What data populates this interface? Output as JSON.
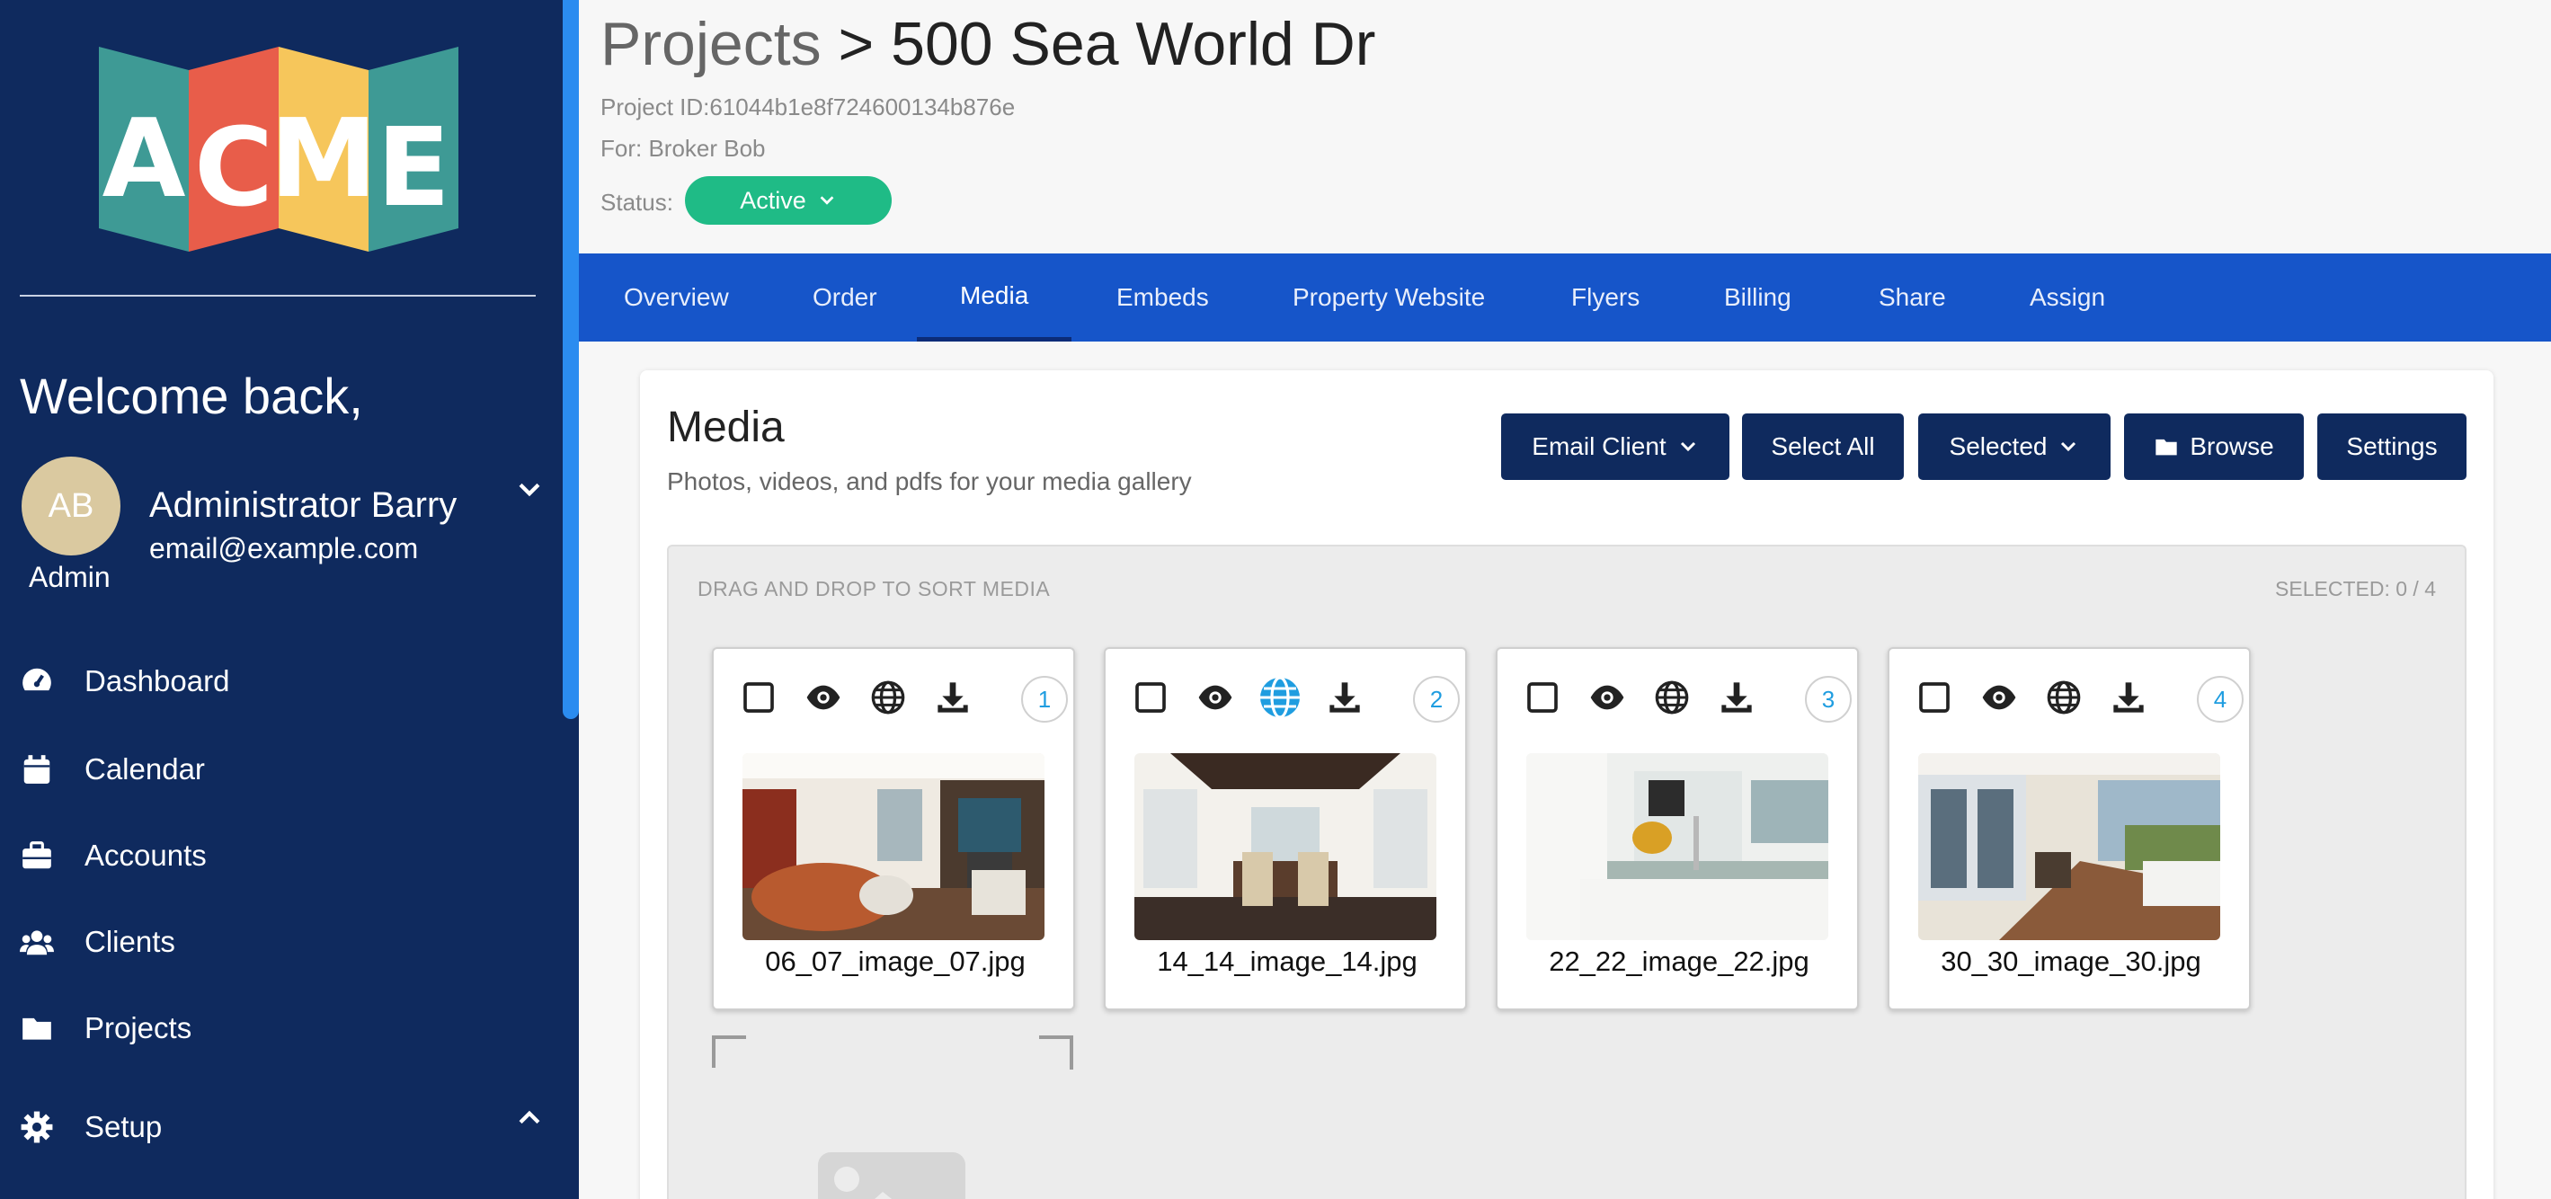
{
  "sidebar": {
    "logo_text": "ACME",
    "welcome": "Welcome back,",
    "user": {
      "initials": "AB",
      "role": "Admin",
      "name": "Administrator Barry",
      "email": "email@example.com"
    },
    "nav": [
      {
        "label": "Dashboard",
        "icon": "gauge-icon"
      },
      {
        "label": "Calendar",
        "icon": "calendar-icon"
      },
      {
        "label": "Accounts",
        "icon": "briefcase-icon"
      },
      {
        "label": "Clients",
        "icon": "users-icon"
      },
      {
        "label": "Projects",
        "icon": "folder-icon"
      },
      {
        "label": "Setup",
        "icon": "gear-icon"
      }
    ]
  },
  "header": {
    "breadcrumb": "Projects",
    "separator": ">",
    "title": "500 Sea World Dr",
    "project_id": "Project ID:61044b1e8f724600134b876e",
    "for": "For: Broker Bob",
    "status_label": "Status:",
    "status_value": "Active"
  },
  "tabs": [
    "Overview",
    "Order",
    "Media",
    "Embeds",
    "Property Website",
    "Flyers",
    "Billing",
    "Share",
    "Assign"
  ],
  "active_tab": "Media",
  "media": {
    "title": "Media",
    "subtitle": "Photos, videos, and pdfs for your media gallery",
    "toolbar": {
      "email_client": "Email Client",
      "select_all": "Select All",
      "selected": "Selected",
      "browse": "Browse",
      "settings": "Settings"
    },
    "drop_label": "DRAG AND DROP TO SORT MEDIA",
    "selected_count": "SELECTED: 0 / 4",
    "items": [
      {
        "index": "1",
        "filename": "06_07_image_07.jpg",
        "public": false
      },
      {
        "index": "2",
        "filename": "14_14_image_14.jpg",
        "public": true
      },
      {
        "index": "3",
        "filename": "22_22_image_22.jpg",
        "public": false
      },
      {
        "index": "4",
        "filename": "30_30_image_30.jpg",
        "public": false
      }
    ]
  },
  "colors": {
    "sidebar": "#0f2a5e",
    "tabbar": "#1655c9",
    "status": "#1fbb86",
    "button": "#0f2a5e",
    "accent": "#1f9de0"
  }
}
